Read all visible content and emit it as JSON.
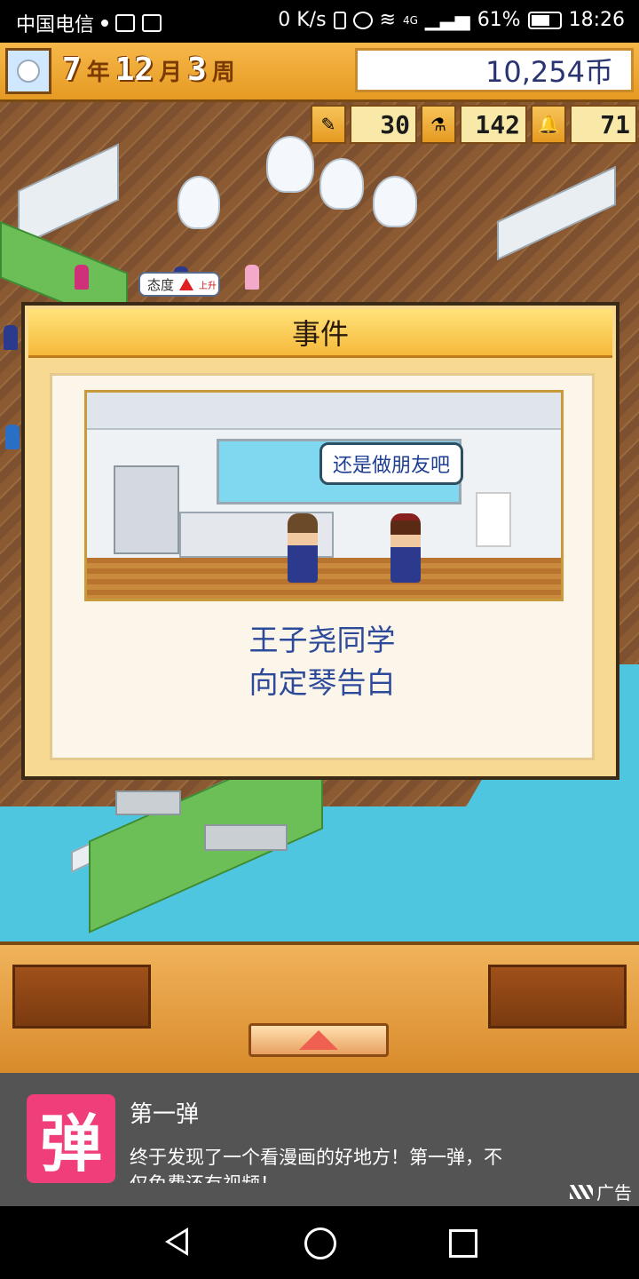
{
  "status_bar": {
    "carrier": "中国电信",
    "speed": "0 K/s",
    "network": "4G",
    "battery": "61%",
    "time": "18:26"
  },
  "hud": {
    "year": "7",
    "year_unit": "年",
    "month": "12",
    "month_unit": "月",
    "week": "3",
    "week_unit": "周",
    "money": "10,254币",
    "stats": [
      {
        "icon": "pencil-icon",
        "value": "30"
      },
      {
        "icon": "flask-icon",
        "value": "142"
      },
      {
        "icon": "bell-icon",
        "value": "71"
      }
    ]
  },
  "world": {
    "attitude_label": "态度",
    "attitude_badge": "上升"
  },
  "event": {
    "title": "事件",
    "speech": "还是做朋友吧",
    "line1": "王子尧同学",
    "line2": "向定琴告白"
  },
  "ad": {
    "logo_text": "弹",
    "title": "第一弹",
    "description": "终于发现了一个看漫画的好地方！第一弹，不仅免费还有视频！",
    "tag": "广告"
  },
  "colors": {
    "hud_orange": "#e59a22",
    "event_text": "#2d4a9a",
    "ad_background": "#545454",
    "ad_logo": "#f03e7a",
    "water": "#4fc6e0"
  }
}
